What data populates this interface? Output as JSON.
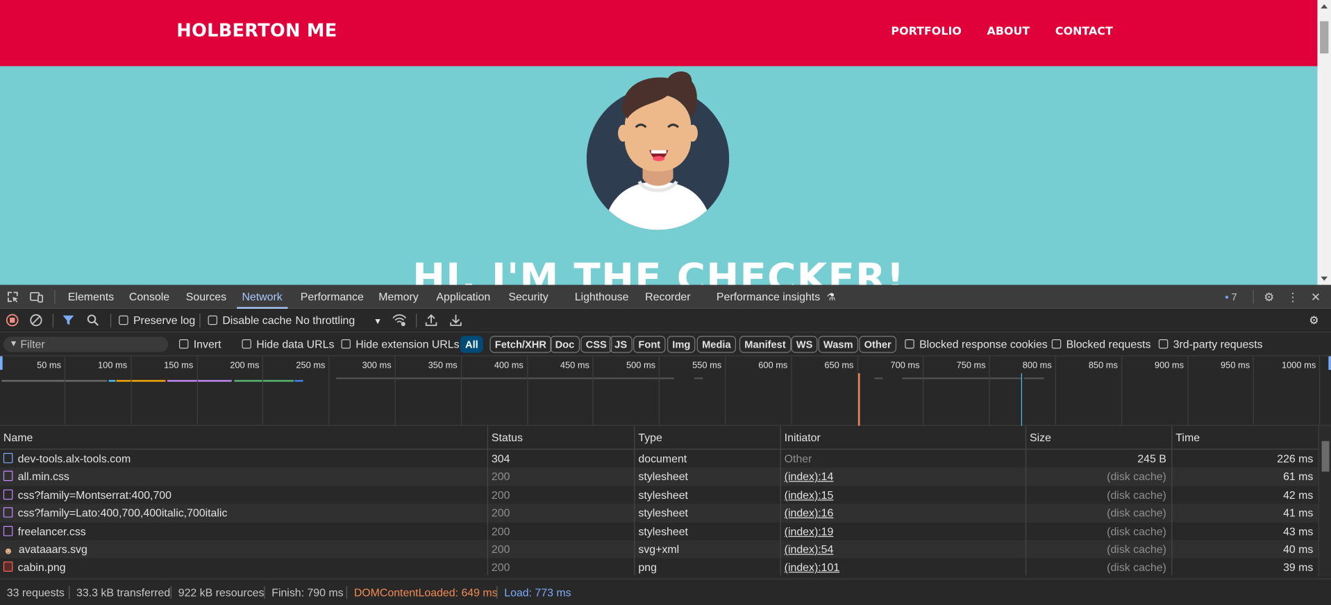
{
  "site": {
    "brand": "HOLBERTON ME",
    "nav": [
      "PORTFOLIO",
      "ABOUT",
      "CONTACT"
    ],
    "hero_title": "HI, I'M THE CHECKER!",
    "colors": {
      "nav_bg": "#e0003a",
      "hero_bg": "#76cdd2"
    }
  },
  "devtools": {
    "tabs": [
      "Elements",
      "Console",
      "Sources",
      "Network",
      "Performance",
      "Memory",
      "Application",
      "Security",
      "Lighthouse",
      "Recorder",
      "Performance insights"
    ],
    "active_tab": "Network",
    "issues_count": "7",
    "toolbar": {
      "preserve_log": "Preserve log",
      "disable_cache": "Disable cache",
      "throttling": "No throttling"
    },
    "filterbar": {
      "filter_placeholder": "Filter",
      "invert": "Invert",
      "hide_data_urls": "Hide data URLs",
      "hide_extension_urls": "Hide extension URLs",
      "chips": [
        "All",
        "Fetch/XHR",
        "Doc",
        "CSS",
        "JS",
        "Font",
        "Img",
        "Media",
        "Manifest",
        "WS",
        "Wasm",
        "Other"
      ],
      "blocked_response_cookies": "Blocked response cookies",
      "blocked_requests": "Blocked requests",
      "third_party": "3rd-party requests"
    },
    "overview_ticks": [
      "50 ms",
      "100 ms",
      "150 ms",
      "200 ms",
      "250 ms",
      "300 ms",
      "350 ms",
      "400 ms",
      "450 ms",
      "500 ms",
      "550 ms",
      "600 ms",
      "650 ms",
      "700 ms",
      "750 ms",
      "800 ms",
      "850 ms",
      "900 ms",
      "950 ms",
      "1000 ms"
    ],
    "table": {
      "columns": [
        "Name",
        "Status",
        "Type",
        "Initiator",
        "Size",
        "Time"
      ],
      "rows": [
        {
          "name": "dev-tools.alx-tools.com",
          "status": "304",
          "type": "document",
          "initiator": "Other",
          "size": "245 B",
          "time": "226 ms",
          "icon": "document-icon"
        },
        {
          "name": "all.min.css",
          "status": "200",
          "type": "stylesheet",
          "initiator": "(index):14",
          "size": "(disk cache)",
          "time": "61 ms",
          "icon": "stylesheet-icon"
        },
        {
          "name": "css?family=Montserrat:400,700",
          "status": "200",
          "type": "stylesheet",
          "initiator": "(index):15",
          "size": "(disk cache)",
          "time": "42 ms",
          "icon": "stylesheet-icon"
        },
        {
          "name": "css?family=Lato:400,700,400italic,700italic",
          "status": "200",
          "type": "stylesheet",
          "initiator": "(index):16",
          "size": "(disk cache)",
          "time": "41 ms",
          "icon": "stylesheet-icon"
        },
        {
          "name": "freelancer.css",
          "status": "200",
          "type": "stylesheet",
          "initiator": "(index):19",
          "size": "(disk cache)",
          "time": "43 ms",
          "icon": "stylesheet-icon"
        },
        {
          "name": "avataaars.svg",
          "status": "200",
          "type": "svg+xml",
          "initiator": "(index):54",
          "size": "(disk cache)",
          "time": "40 ms",
          "icon": "svg-image-icon"
        },
        {
          "name": "cabin.png",
          "status": "200",
          "type": "png",
          "initiator": "(index):101",
          "size": "(disk cache)",
          "time": "39 ms",
          "icon": "png-image-icon"
        }
      ]
    },
    "status": {
      "requests": "33 requests",
      "transferred": "33.3 kB transferred",
      "resources": "922 kB resources",
      "finish": "Finish: 790 ms",
      "dom_content_loaded": "DOMContentLoaded: 649 ms",
      "load": "Load: 773 ms"
    }
  }
}
